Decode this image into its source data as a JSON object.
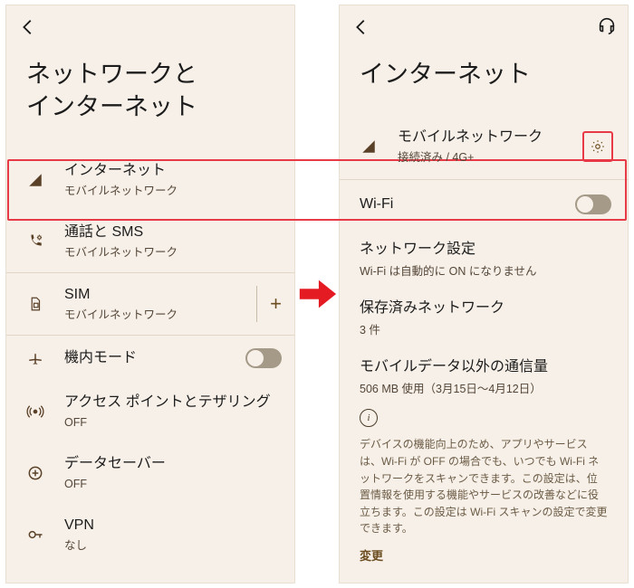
{
  "left": {
    "title_line1": "ネットワークと",
    "title_line2": "インターネット",
    "rows": {
      "internet": {
        "label": "インターネット",
        "sub": "モバイルネットワーク"
      },
      "calls": {
        "label": "通話と SMS",
        "sub": "モバイルネットワーク"
      },
      "sim": {
        "label": "SIM",
        "sub": "モバイルネットワーク"
      },
      "airplane": {
        "label": "機内モード"
      },
      "hotspot": {
        "label": "アクセス ポイントとテザリング",
        "sub": "OFF"
      },
      "datasaver": {
        "label": "データセーバー",
        "sub": "OFF"
      },
      "vpn": {
        "label": "VPN",
        "sub": "なし"
      }
    }
  },
  "right": {
    "title": "インターネット",
    "mobile": {
      "label": "モバイルネットワーク",
      "sub": "接続済み / 4G+"
    },
    "wifi": {
      "label": "Wi-Fi"
    },
    "netset": {
      "label": "ネットワーク設定",
      "sub": "Wi-Fi は自動的に ON になりません"
    },
    "saved": {
      "label": "保存済みネットワーク",
      "sub": "3 件"
    },
    "nonmobile": {
      "label": "モバイルデータ以外の通信量",
      "sub": "506 MB 使用（3月15日～4月12日）"
    },
    "note": "デバイスの機能向上のため、アプリやサービスは、Wi-Fi が OFF の場合でも、いつでも Wi-Fi ネットワークをスキャンできます。この設定は、位置情報を使用する機能やサービスの改善などに役立ちます。この設定は Wi-Fi スキャンの設定で変更できます。",
    "change": "変更"
  }
}
